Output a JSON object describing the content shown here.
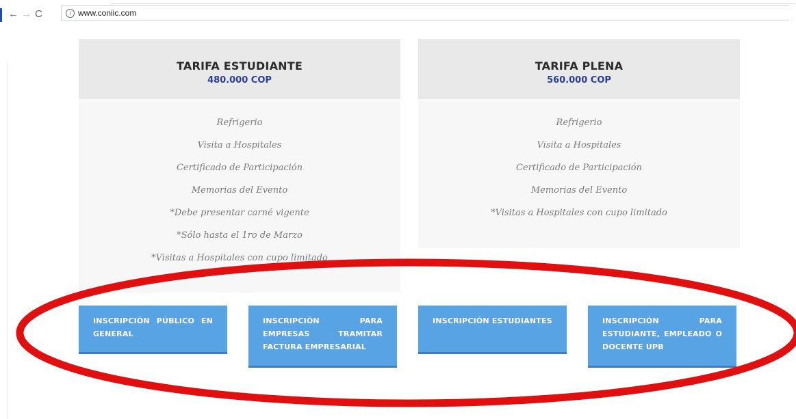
{
  "browser": {
    "url": "www.coniic.com",
    "back_icon": "←",
    "forward_icon": "→",
    "reload_icon": "C",
    "info_icon": "i"
  },
  "cards": [
    {
      "title": "TARIFA ESTUDIANTE",
      "price": "480.000 COP",
      "features": [
        "Refrigerio",
        "Visita a Hospitales",
        "Certificado de Participación",
        "Memorias del Evento",
        "*Debe presentar carné vigente",
        "*Sólo hasta el 1ro de Marzo",
        "*Visitas a Hospitales con cupo limitado"
      ]
    },
    {
      "title": "TARIFA PLENA",
      "price": "560.000 COP",
      "features": [
        "Refrigerio",
        "Visita a Hospitales",
        "Certificado de Participación",
        "Memorias del Evento",
        "*Visitas a Hospitales con cupo limitado"
      ]
    }
  ],
  "buttons": [
    "INSCRIPCIÓN PÚBLICO EN GENERAL",
    "INSCRIPCIÓN PARA EMPRESAS TRAMITAR FACTURA EMPRESARIAL",
    "INSCRIPCIÓN ESTUDIANTES",
    "INSCRIPCIÓN PARA ESTUDIANTE, EMPLEADO O DOCENTE UPB"
  ],
  "colors": {
    "button": "#58a3e4",
    "price": "#2b3e91",
    "annotation": "#e01010"
  }
}
